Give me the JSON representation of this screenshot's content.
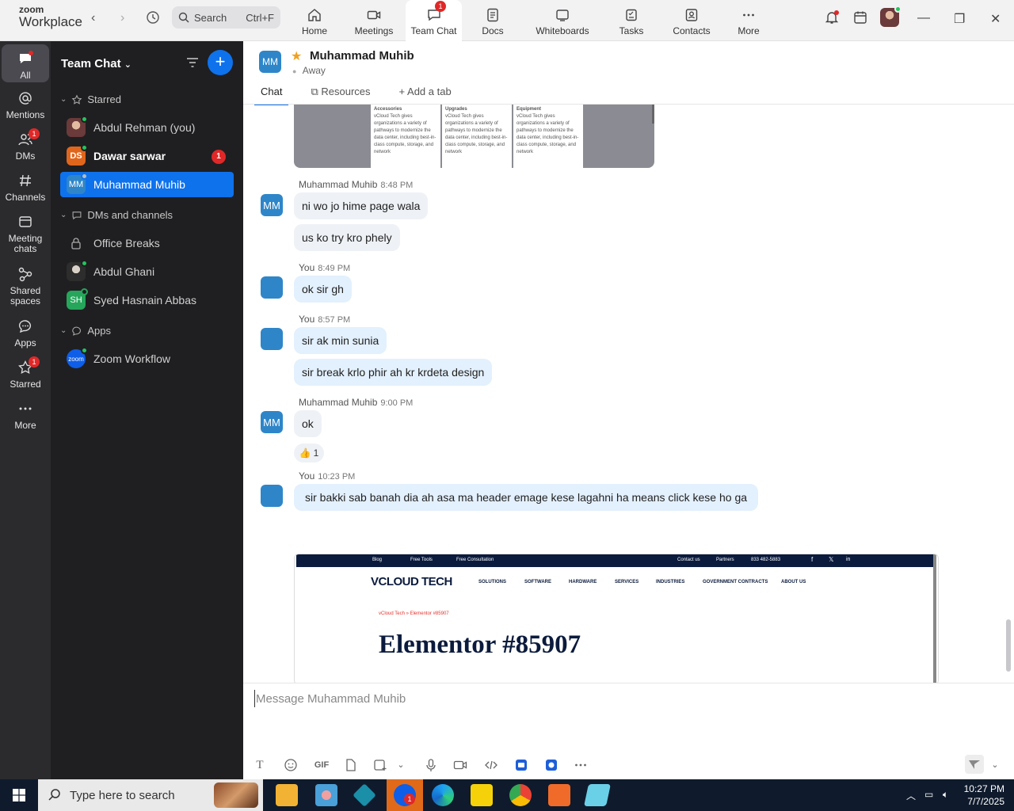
{
  "app": {
    "brand_top": "zoom",
    "brand_bottom": "Workplace"
  },
  "topbar": {
    "search_label": "Search",
    "search_shortcut": "Ctrl+F",
    "tabs": [
      {
        "label": "Home",
        "icon": "home-icon"
      },
      {
        "label": "Meetings",
        "icon": "video-camera-icon"
      },
      {
        "label": "Team Chat",
        "icon": "chat-bubble-icon",
        "badge": "1",
        "active": true
      },
      {
        "label": "Docs",
        "icon": "doc-icon"
      },
      {
        "label": "Whiteboards",
        "icon": "whiteboard-icon"
      },
      {
        "label": "Tasks",
        "icon": "tasks-icon"
      },
      {
        "label": "Contacts",
        "icon": "contacts-icon"
      },
      {
        "label": "More",
        "icon": "more-dots-icon"
      }
    ]
  },
  "rail": {
    "items": [
      {
        "label": "All",
        "icon": "chat-icon",
        "active": true
      },
      {
        "label": "Mentions",
        "icon": "at-icon"
      },
      {
        "label": "DMs",
        "icon": "people-icon",
        "badge": "1"
      },
      {
        "label": "Channels",
        "icon": "hash-icon"
      },
      {
        "label": "Meeting chats",
        "icon": "calendar-chat-icon"
      },
      {
        "label": "Shared spaces",
        "icon": "shared-spaces-icon"
      },
      {
        "label": "Apps",
        "icon": "apps-chat-icon"
      },
      {
        "label": "Starred",
        "icon": "star-icon",
        "badge": "1"
      },
      {
        "label": "More",
        "icon": "more-dots-icon"
      }
    ]
  },
  "sidebar": {
    "title": "Team Chat",
    "sections": {
      "starred": "Starred",
      "dms": "DMs and channels",
      "apps": "Apps"
    },
    "starred_items": [
      {
        "name": "Abdul Rehman (you)",
        "avatar": "photo"
      },
      {
        "name": "Dawar sarwar",
        "initials": "DS",
        "badge": "1",
        "bold": true
      },
      {
        "name": "Muhammad Muhib",
        "initials": "MM",
        "active": true
      }
    ],
    "dm_items": [
      {
        "name": "Office Breaks",
        "icon": "lock-icon"
      },
      {
        "name": "Abdul Ghani",
        "avatar": "photo"
      },
      {
        "name": "Syed Hasnain Abbas",
        "initials": "SH"
      }
    ],
    "app_items": [
      {
        "name": "Zoom Workflow",
        "initials": "zoom"
      }
    ]
  },
  "chat": {
    "contact_initials": "MM",
    "contact_name": "Muhammad Muhib",
    "contact_status": "Away",
    "tabs": [
      "Chat",
      "Resources",
      "Add a tab"
    ],
    "preview_card": {
      "cols": [
        {
          "heading": "Accessories",
          "body": "vCloud Tech gives organizations a variety of pathways to modernize the data center, including best-in-class compute, storage, and network"
        },
        {
          "heading": "Upgrades",
          "body": "vCloud Tech gives organizations a variety of pathways to modernize the data center, including best-in-class compute, storage, and network"
        },
        {
          "heading": "Equipment",
          "body": "vCloud Tech gives organizations a variety of pathways to modernize the data center, including best-in-class compute, storage, and network"
        }
      ]
    },
    "messages": [
      {
        "sender": "Muhammad Muhib",
        "time": "8:48 PM",
        "bubbles": [
          "ni wo jo hime page wala",
          "us ko try kro phely"
        ]
      },
      {
        "sender": "You",
        "time": "8:49 PM",
        "bubbles": [
          "ok sir gh"
        ]
      },
      {
        "sender": "You",
        "time": "8:57 PM",
        "bubbles": [
          "sir ak min sunia",
          "sir break krlo phir ah kr krdeta design"
        ]
      },
      {
        "sender": "Muhammad Muhib",
        "time": "9:00 PM",
        "bubbles": [
          "ok"
        ],
        "reaction": {
          "emoji": "👍",
          "count": "1"
        }
      },
      {
        "sender": "You",
        "time": "10:23 PM",
        "bubbles": [
          "sir bakki sab banah dia ah asa ma header emage kese lagahni ha means click kese ho ga"
        ]
      }
    ],
    "screenshot": {
      "top_links": [
        "Blog",
        "Free Tools",
        "Free Consultation",
        "Contact us",
        "Partners",
        "833 482-5883"
      ],
      "brand": "VCLOUD TECH",
      "menu": [
        "SOLUTIONS",
        "SOFTWARE",
        "HARDWARE",
        "SERVICES",
        "INDUSTRIES",
        "GOVERNMENT CONTRACTS",
        "ABOUT US"
      ],
      "breadcrumb": "vCloud Tech  »  Elementor #85907",
      "heading": "Elementor #85907"
    },
    "composer_placeholder": "Message Muhammad Muhib",
    "composer_tools": [
      "text-format-icon",
      "emoji-icon",
      "GIF",
      "file-icon",
      "screenshot-icon",
      "chevron-down-icon",
      "mic-icon",
      "video-message-icon",
      "code-icon",
      "app-icon",
      "app-icon-2",
      "more-dots-icon"
    ]
  },
  "taskbar": {
    "search_placeholder": "Type here to search",
    "time": "10:27 PM",
    "date": "7/7/2025",
    "zoom_badge": "1"
  },
  "colors": {
    "accent": "#0e72ed",
    "badge": "#e02828",
    "rail": "#2b2b2e",
    "sidebar": "#1f1f21"
  }
}
